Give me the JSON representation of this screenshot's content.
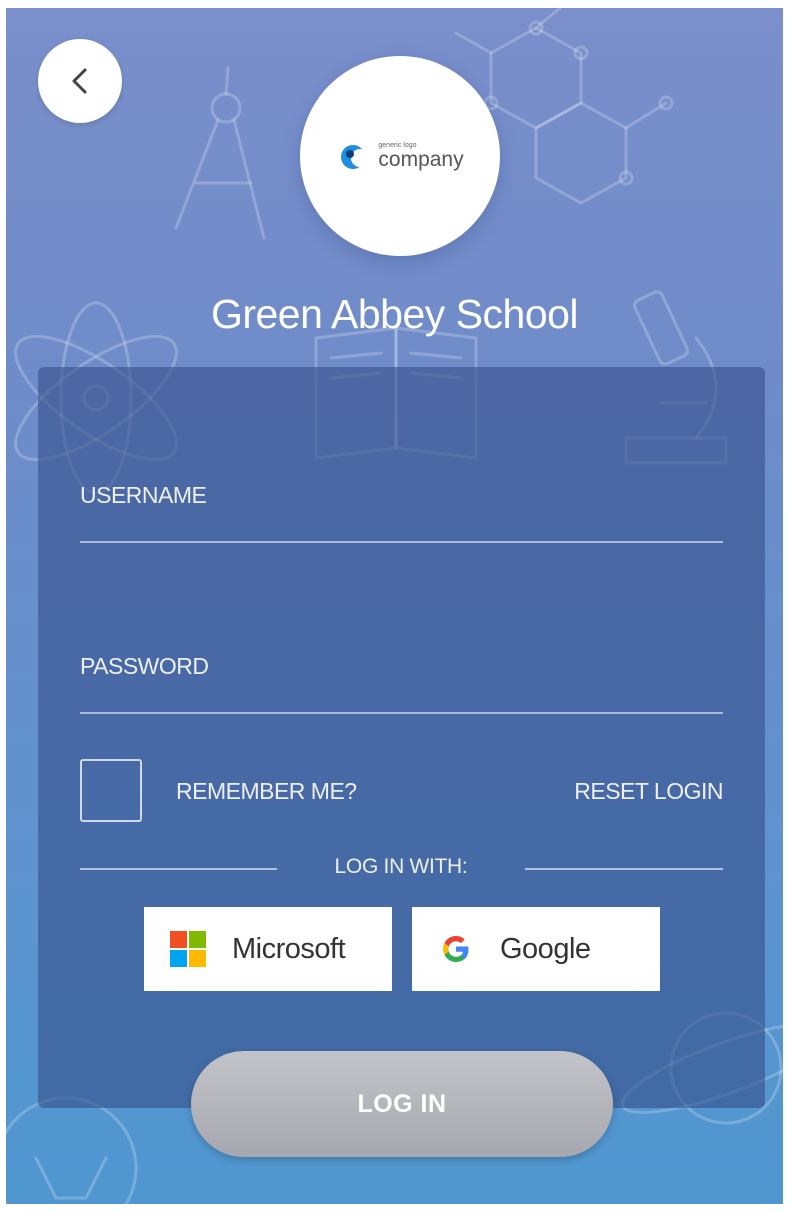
{
  "header": {
    "back_icon": "chevron-left-icon"
  },
  "logo": {
    "small_text": "generic logo",
    "big_text": "company"
  },
  "school": {
    "name": "Green Abbey School"
  },
  "form": {
    "username_label": "USERNAME",
    "password_label": "PASSWORD",
    "remember_label": "REMEMBER ME?",
    "reset_label": "RESET LOGIN",
    "divider_text": "LOG IN WITH:",
    "sso": [
      {
        "label": "Microsoft",
        "icon": "microsoft-icon"
      },
      {
        "label": "Google",
        "icon": "google-icon"
      }
    ],
    "login_label": "LOG IN"
  },
  "colors": {
    "background_top": "#7a8fcb",
    "background_bottom": "#4f97d0",
    "card": "#37508c",
    "login_button": "#b0b2b8"
  }
}
